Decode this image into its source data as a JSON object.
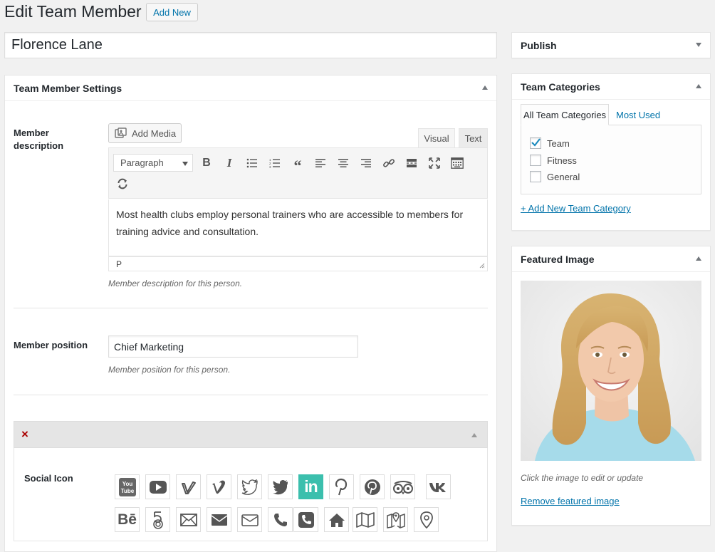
{
  "header": {
    "title": "Edit Team Member",
    "add_new_label": "Add New"
  },
  "post_title": "Florence Lane",
  "settings_box": {
    "title": "Team Member Settings",
    "description": {
      "label": "Member description",
      "add_media_label": "Add Media",
      "tab_visual": "Visual",
      "tab_text": "Text",
      "format_select": "Paragraph",
      "content": "Most health clubs employ personal trainers who are accessible to members for training advice and consultation.",
      "path": "P",
      "help": "Member description for this person."
    },
    "position": {
      "label": "Member position",
      "value": "Chief Marketing",
      "help": "Member position for this person."
    },
    "social": {
      "label": "Social Icon",
      "active_color": "#3bbfad",
      "icons_row1": [
        "youtube-square-icon",
        "youtube-icon",
        "vimeo-square-icon",
        "vimeo-icon",
        "twitter-outline-icon",
        "twitter-icon",
        "linkedin-icon",
        "pinterest-icon",
        "pinterest-circle-icon",
        "tripadvisor-icon",
        "vk-icon"
      ],
      "icons_row2": [
        "behance-icon",
        "500px-icon",
        "envelope-outline-icon",
        "envelope-icon",
        "envelope-open-icon",
        "phone-icon",
        "phone-square-icon",
        "home-icon",
        "map-icon",
        "map-marker-square-icon",
        "map-pin-icon"
      ]
    }
  },
  "publish_box": {
    "title": "Publish"
  },
  "categories_box": {
    "title": "Team Categories",
    "tab_all": "All Team Categories",
    "tab_most_used": "Most Used",
    "items": [
      {
        "label": "Team",
        "checked": true
      },
      {
        "label": "Fitness",
        "checked": false
      },
      {
        "label": "General",
        "checked": false
      }
    ],
    "add_new_link": "+ Add New Team Category"
  },
  "featured_box": {
    "title": "Featured Image",
    "help": "Click the image to edit or update",
    "remove_link": "Remove featured image"
  }
}
